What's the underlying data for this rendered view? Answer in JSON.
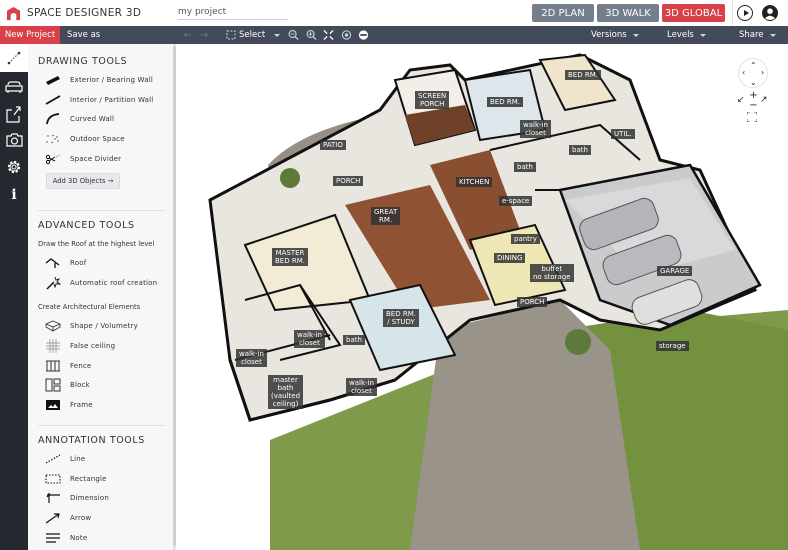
{
  "header": {
    "app_title": "SPACE DESIGNER 3D",
    "project_name": "my project",
    "view_buttons": [
      "2D PLAN",
      "3D WALK",
      "3D GLOBAL"
    ],
    "active_view": "3D GLOBAL",
    "brand_color": "#d9414a",
    "icons": [
      "logo-icon",
      "play-icon",
      "user-account-icon"
    ]
  },
  "toolbar": {
    "new_project": "New Project",
    "save_as": "Save as",
    "select": "Select",
    "icons": [
      "undo-icon",
      "redo-icon",
      "select-icon",
      "zoom-out-icon",
      "zoom-in-icon",
      "fit-screen-icon",
      "center-icon",
      "hide-icon"
    ],
    "menus": [
      "Versions",
      "Levels",
      "Share"
    ]
  },
  "rail": {
    "icons": [
      "measure-icon",
      "furniture-icon",
      "export-icon",
      "camera-icon",
      "settings-icon",
      "info-icon"
    ]
  },
  "panel": {
    "drawing": {
      "title": "DRAWING TOOLS",
      "items": [
        {
          "label": "Exterior / Bearing Wall",
          "icon": "exterior-wall-icon"
        },
        {
          "label": "Interior / Partition Wall",
          "icon": "interior-wall-icon"
        },
        {
          "label": "Curved Wall",
          "icon": "curved-wall-icon"
        },
        {
          "label": "Outdoor Space",
          "icon": "outdoor-space-icon"
        },
        {
          "label": "Space Divider",
          "icon": "space-divider-icon"
        }
      ],
      "add_button": "Add 3D Objects →"
    },
    "advanced": {
      "title": "ADVANCED TOOLS",
      "roof_subtitle": "Draw the Roof at the highest level",
      "roof_items": [
        {
          "label": "Roof",
          "icon": "roof-icon"
        },
        {
          "label": "Automatic roof creation",
          "icon": "magic-wand-icon"
        }
      ],
      "arch_subtitle": "Create Architectural Elements",
      "arch_items": [
        {
          "label": "Shape / Volumetry",
          "icon": "shape-icon"
        },
        {
          "label": "False ceiling",
          "icon": "false-ceiling-icon"
        },
        {
          "label": "Fence",
          "icon": "fence-icon"
        },
        {
          "label": "Block",
          "icon": "block-icon"
        },
        {
          "label": "Frame",
          "icon": "frame-icon"
        }
      ]
    },
    "annotation": {
      "title": "ANNOTATION TOOLS",
      "items": [
        {
          "label": "Line",
          "icon": "line-icon"
        },
        {
          "label": "Rectangle",
          "icon": "rectangle-icon"
        },
        {
          "label": "Dimension",
          "icon": "dimension-icon"
        },
        {
          "label": "Arrow",
          "icon": "arrow-icon"
        },
        {
          "label": "Note",
          "icon": "note-icon"
        }
      ]
    }
  },
  "plan": {
    "rooms": [
      "SCREEN\nPORCH",
      "BED RM.",
      "BED RM.",
      "walk-in\ncloset",
      "UTIL.",
      "bath",
      "bath",
      "PATIO",
      "PORCH",
      "KITCHEN",
      "e-space",
      "GREAT\nRM.",
      "MASTER\nBED RM.",
      "pantry",
      "DINING",
      "buffet\nno storage",
      "GARAGE",
      "PORCH",
      "BED RM.\n/ STUDY",
      "bath",
      "walk-in\ncloset",
      "walk-in\ncloset",
      "master\nbath\n(vaulted\nceiling)",
      "walk-in\ncloset",
      "storage"
    ]
  },
  "nav": {
    "icons": [
      "pan-control-icon",
      "rotate-left-icon",
      "zoom-plus-icon",
      "zoom-minus-icon",
      "rotate-right-icon",
      "fullscreen-icon"
    ]
  }
}
